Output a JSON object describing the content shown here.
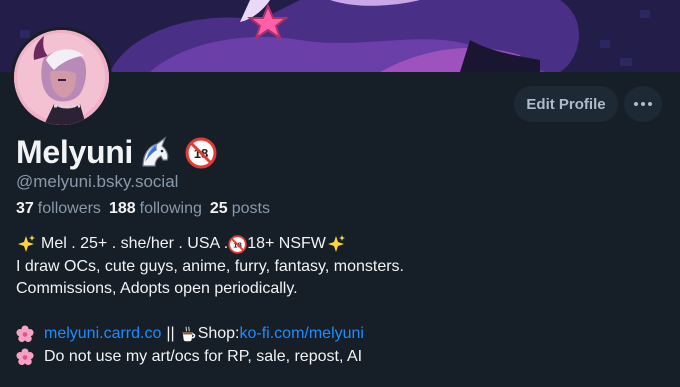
{
  "profile": {
    "display_name": "Melyuni",
    "handle": "@melyuni.bsky.social",
    "name_icons": [
      "unicorn-icon",
      "no-under-18-icon"
    ]
  },
  "actions": {
    "edit_profile_label": "Edit Profile",
    "more_icon": "ellipsis-icon"
  },
  "stats": {
    "followers_count": "37",
    "followers_label": "followers",
    "following_count": "188",
    "following_label": "following",
    "posts_count": "25",
    "posts_label": "posts"
  },
  "bio": {
    "line1_text": "Mel . 25+ . she/her . USA . ",
    "line1_tail": "18+ NSFW",
    "line2": "I draw OCs, cute guys, anime, furry, fantasy, monsters.",
    "line3": "Commissions, Adopts open periodically.",
    "carrd_link": "melyuni.carrd.co",
    "separator": "||",
    "shop_label": "Shop: ",
    "kofi_link": "ko-fi.com/melyuni",
    "line6": "Do not use my art/ocs for RP, sale, repost, AI"
  },
  "colors": {
    "background": "#161e27",
    "link": "#208bfe",
    "muted_text": "#8899aa",
    "button_bg": "#1e2936"
  }
}
